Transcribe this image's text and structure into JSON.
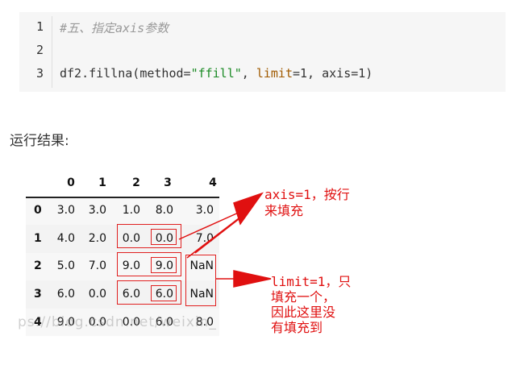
{
  "code": {
    "line_numbers": [
      "1",
      "2",
      "3"
    ],
    "line1_comment": "#五、指定axis参数",
    "line3": {
      "prefix": "df2.fillna(method=",
      "method_value": "\"ffill\"",
      "sep1": ", ",
      "limit_kw": "limit",
      "limit_rest": "=1, axis=1)"
    }
  },
  "result_label": "运行结果:",
  "table": {
    "columns": [
      "0",
      "1",
      "2",
      "3",
      "4"
    ],
    "rows": [
      {
        "index": "0",
        "values": [
          "3.0",
          "3.0",
          "1.0",
          "8.0",
          "3.0"
        ]
      },
      {
        "index": "1",
        "values": [
          "4.0",
          "2.0",
          "0.0",
          "0.0",
          "7.0"
        ]
      },
      {
        "index": "2",
        "values": [
          "5.0",
          "7.0",
          "9.0",
          "9.0",
          "NaN"
        ]
      },
      {
        "index": "3",
        "values": [
          "6.0",
          "0.0",
          "6.0",
          "6.0",
          "NaN"
        ]
      },
      {
        "index": "4",
        "values": [
          "9.0",
          "0.0",
          "0.0",
          "6.0",
          "8.0"
        ]
      }
    ]
  },
  "annotations": {
    "axis_line1": "axis=1，按行",
    "axis_line2": "来填充",
    "limit_line1": "limit=1，只",
    "limit_line2": "填充一个，",
    "limit_line3": "因此这里没",
    "limit_line4": "有填充到"
  },
  "watermark": "ps://blog.csdn.net/weixin_",
  "colors": {
    "annotation": "#e01010",
    "string": "#1a8a24",
    "keyword": "#a05a00"
  }
}
